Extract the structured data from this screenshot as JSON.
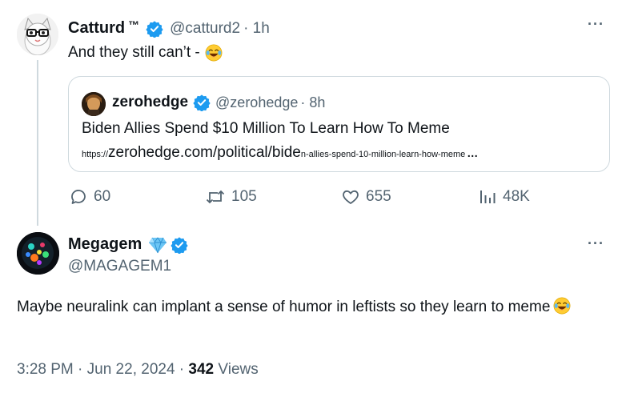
{
  "tweet1": {
    "name": "Catturd",
    "name_suffix": "™",
    "handle": "@catturd2",
    "time": "· 1h",
    "text": "And they still can’t -",
    "more": "···",
    "quote": {
      "name": "zerohedge",
      "handle": "@zerohedge",
      "time": "· 8h",
      "title": "Biden Allies Spend $10 Million To Learn How To Meme",
      "url_prefix": "https://",
      "url_main": "zerohedge.com/political/bide",
      "url_rest": "n-allies-spend-10-million-learn-how-meme",
      "url_ellipsis": "…"
    },
    "actions": {
      "replies": "60",
      "reposts": "105",
      "likes": "655",
      "views": "48K"
    }
  },
  "tweet2": {
    "name": "Megagem",
    "handle": "@MAGAGEM1",
    "more": "···",
    "text": "Maybe neuralink can implant a sense of humor in leftists so they learn to meme",
    "time": "3:28 PM · Jun 22, 2024 ·",
    "views_count": "342",
    "views_label": "Views"
  },
  "icons": {
    "verified": "verified-badge-icon",
    "emoji": "face-with-tears-of-joy-icon",
    "diamond": "gem-icon",
    "reply": "reply-icon",
    "repost": "repost-icon",
    "like": "heart-icon",
    "views": "views-chart-icon"
  },
  "colors": {
    "verified_blue": "#1d9bf0",
    "secondary_text": "#536471",
    "border": "#cfd9de",
    "gem_blue": "#6cc6f5"
  }
}
